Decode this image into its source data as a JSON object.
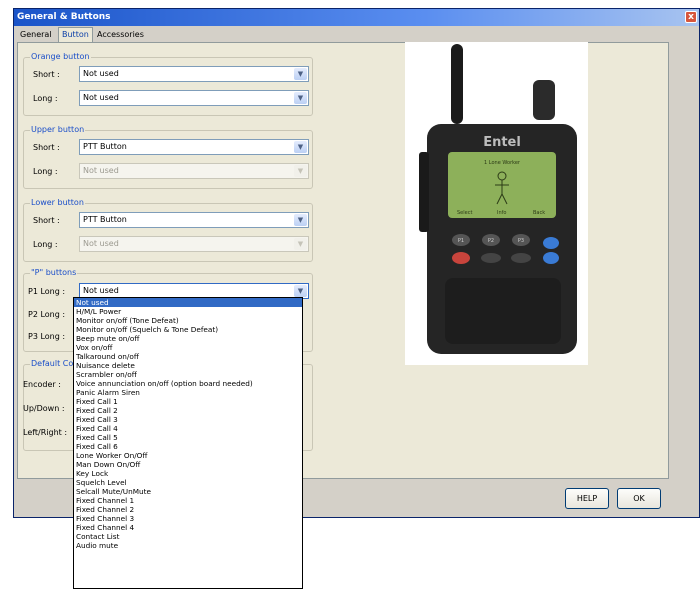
{
  "window": {
    "title": "General & Buttons",
    "close_glyph": "x"
  },
  "tabs": [
    {
      "label": "General",
      "active": false
    },
    {
      "label": "Button",
      "active": true
    },
    {
      "label": "Accessories Socket",
      "active": false
    }
  ],
  "orange": {
    "legend": "Orange button",
    "short_label": "Short :",
    "short_value": "Not used",
    "long_label": "Long :",
    "long_value": "Not used"
  },
  "upper": {
    "legend": "Upper button",
    "short_label": "Short :",
    "short_value": "PTT Button",
    "long_label": "Long :",
    "long_value": "Not used"
  },
  "lower": {
    "legend": "Lower button",
    "short_label": "Short :",
    "short_value": "PTT Button",
    "long_label": "Long :",
    "long_value": "Not used"
  },
  "p_buttons": {
    "legend": "\"P\" buttons",
    "p1_label": "P1 Long :",
    "p1_value": "Not used",
    "p2_label": "P2 Long :",
    "p3_label": "P3 Long :"
  },
  "default_controls": {
    "legend": "Default Con",
    "encoder_label": "Encoder :",
    "updown_label": "Up/Down :",
    "leftright_label": "Left/Right :"
  },
  "radio": {
    "brand": "Entel",
    "screen_line1": "1 Lone Worker",
    "soft_left": "Select",
    "soft_mid": "Info",
    "soft_right": "Back",
    "key_p1": "P1",
    "key_p2": "P2",
    "key_p3": "P3"
  },
  "buttons": {
    "help": "HELP",
    "ok": "OK"
  },
  "dropdown_options": [
    "Not used",
    "H/M/L Power",
    "Monitor on/off (Tone Defeat)",
    "Monitor on/off (Squelch & Tone Defeat)",
    "Beep mute on/off",
    "Vox on/off",
    "Talkaround on/off",
    "Nuisance delete",
    "Scrambler on/off",
    "Voice annunciation on/off (option board needed)",
    "Panic Alarm Siren",
    "Fixed Call 1",
    "Fixed Call 2",
    "Fixed Call 3",
    "Fixed Call 4",
    "Fixed Call 5",
    "Fixed Call 6",
    "Lone Worker On/Off",
    "Man Down On/Off",
    "Key Lock",
    "Squelch Level",
    "Selcall Mute/UnMute",
    "Fixed Channel 1",
    "Fixed Channel 2",
    "Fixed Channel 3",
    "Fixed Channel 4",
    "Contact List",
    "Audio mute"
  ],
  "dropdown_selected_index": 0,
  "colors": {
    "title_bar": "#1a54c9",
    "legend": "#1a4ec9",
    "selection": "#316ac5"
  },
  "icons": {
    "combo_arrow": "chevron-down-icon",
    "close": "close-icon"
  }
}
